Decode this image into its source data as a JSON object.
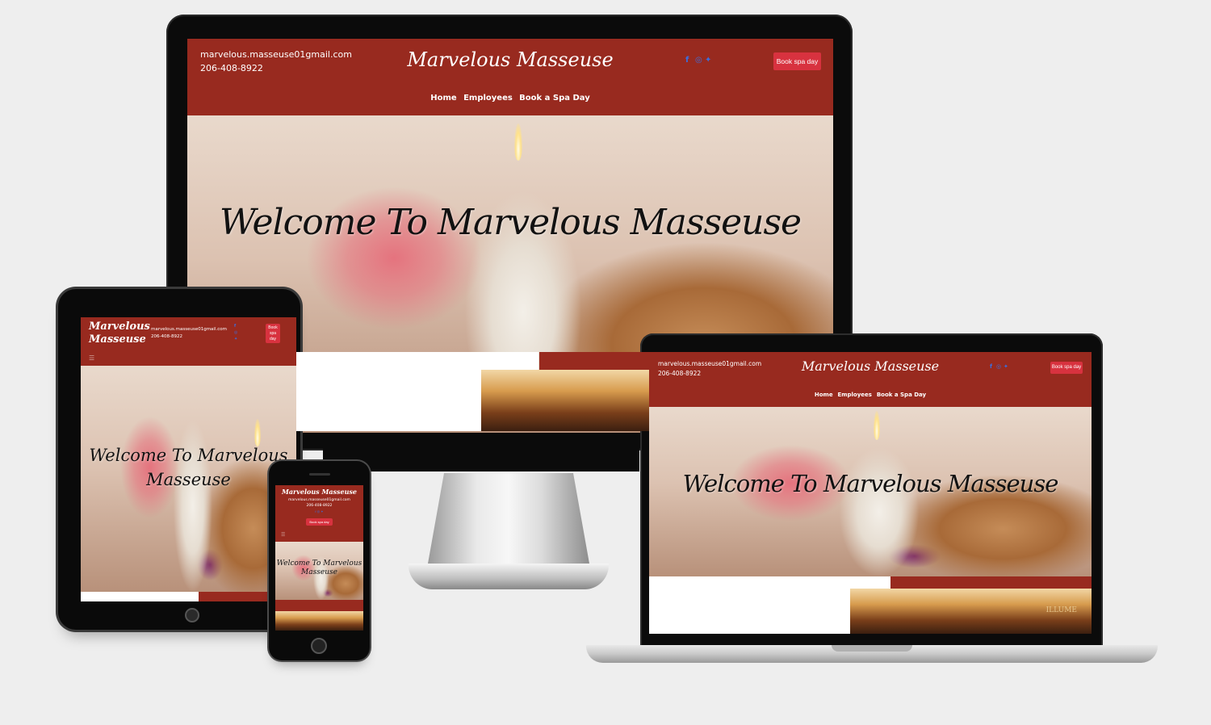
{
  "site": {
    "brand": "Marvelous Masseuse",
    "email": "marvelous.masseuse01gmail.com",
    "phone": "206-408-8922",
    "book_button": "Book spa day",
    "book_button_tablet_lines": [
      "Book",
      "spa",
      "day"
    ],
    "brand_tablet_lines": [
      "Marvelous",
      "Masseuse"
    ],
    "nav": [
      "Home",
      "Employees",
      "Book a Spa Day"
    ],
    "hero_title": "Welcome To Marvelous Masseuse",
    "hero_title_tablet_lines": [
      "Welcome To Marvelous",
      "Masseuse"
    ],
    "hero_title_phone_lines": [
      "Welcome To Marvelous",
      "Masseuse"
    ],
    "social_icons": [
      "facebook-icon",
      "instagram-icon",
      "twitter-icon"
    ],
    "hamburger_icon": "menu-icon",
    "sign_text": "ILLUME",
    "colors": {
      "header": "#982a1f",
      "button": "#d8323f",
      "social": "#3b6fe0",
      "hero_text": "#111111"
    }
  }
}
